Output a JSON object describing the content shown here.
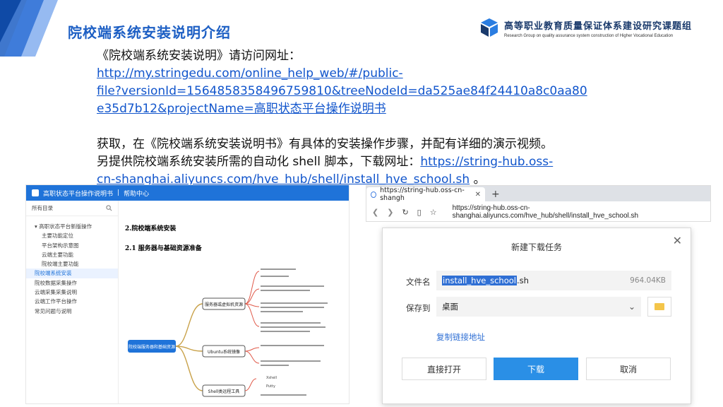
{
  "header": {
    "title": "院校端系统安装说明介绍",
    "logo_cn": "高等职业教育质量保证体系建设研究课题组",
    "logo_en": "Research Group on quality assurance system construction of Higher Vocational Education"
  },
  "body": {
    "line1": "《院校端系统安装说明》请访问网址：",
    "link1_l1": "http://my.stringedu.com/online_help_web/#/public-",
    "link1_l2": "file?versionId=1564858358496759810&treeNodeId=da525ae84f24410a8c0aa80",
    "link1_l3": "e35d7b12&projectName=高职状态平台操作说明书",
    "para2_l1": "获取，在《院校端系统安装说明书》有具体的安装操作步骤，并配有详细的演示视频。",
    "para2_l2_prefix": "另提供院校端系统安装所需的自动化 shell 脚本，下载网址：",
    "link2_l1": "https://string-hub.oss-",
    "link2_l2": "cn-shanghai.aliyuncs.com/hve_hub/shell/install_hve_school.sh",
    "para2_end": " 。"
  },
  "shot1": {
    "topbar_title": "高职状态平台操作说明书",
    "topbar_sep": "|",
    "topbar_help": "帮助中心",
    "sidebar_title": "所有目录",
    "sidebar_items": [
      "高职状态平台新版操作",
      "主要功能定位",
      "平台架构示意图",
      "云端主要功能",
      "院校端主要功能",
      "院校端系统安装",
      "院校数据采集操作",
      "云端采集采集说明",
      "云端工作平台操作",
      "常见问题与说明"
    ],
    "h1": "2.院校端系统安装",
    "h2": "2.1 服务器与基础资源准备",
    "mind_root": "院校端服务器和基础资源",
    "mind_b1": "服务器或虚拟机资源",
    "mind_b2": "Ubuntu系统镜像",
    "mind_b3": "Shell类远程工具",
    "mind_b3_sub1": "Xshell",
    "mind_b3_sub2": "Putty"
  },
  "browser": {
    "tab_label": "https://string-hub.oss-cn-shangh",
    "address": "https://string-hub.oss-cn-shanghai.aliyuncs.com/hve_hub/shell/install_hve_school.sh"
  },
  "dialog": {
    "title": "新建下载任务",
    "filename_label": "文件名",
    "filename_selected": "install_hve_school",
    "filename_ext": ".sh",
    "filesize": "964.04KB",
    "saveto_label": "保存到",
    "saveto_value": "桌面",
    "copy_link": "复制链接地址",
    "btn_open": "直接打开",
    "btn_download": "下载",
    "btn_cancel": "取消"
  },
  "colors": {
    "title_blue": "#1d5fc4",
    "link_blue": "#1155cc",
    "primary_button": "#2a8fe6"
  }
}
